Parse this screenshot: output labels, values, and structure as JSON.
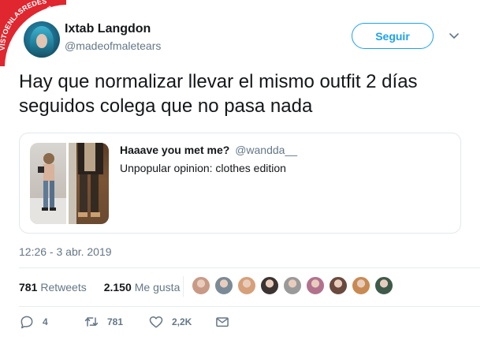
{
  "watermark": {
    "text": "VISTOENLASREDES",
    "suffix": ".com"
  },
  "author": {
    "name": "Ixtab Langdon",
    "handle": "@madeofmaletears"
  },
  "follow_button": {
    "label": "Seguir"
  },
  "tweet": {
    "text": "Hay que normalizar llevar el mismo outfit 2 días seguidos colega que no pasa nada"
  },
  "quoted_tweet": {
    "name": "Haaave you met me?",
    "handle": "@wandda__",
    "text": "Unpopular opinion: clothes edition"
  },
  "timestamp": "12:26 - 3 abr. 2019",
  "stats": {
    "retweets_count": "781",
    "retweets_label": "Retweets",
    "likes_count": "2.150",
    "likes_label": "Me gusta"
  },
  "liker_avatars": [
    {
      "color": "#c89a86"
    },
    {
      "color": "#7a8a96"
    },
    {
      "color": "#d6a07a"
    },
    {
      "color": "#3c3432"
    },
    {
      "color": "#9a9a9a"
    },
    {
      "color": "#b2728e"
    },
    {
      "color": "#6a4a3e"
    },
    {
      "color": "#c88a52"
    },
    {
      "color": "#3e5a4a"
    }
  ],
  "actions": {
    "replies": "4",
    "retweets": "781",
    "likes": "2,2K"
  },
  "colors": {
    "accent": "#1da1f2",
    "secondary_text": "#657786",
    "border": "#e1e8ed",
    "watermark_red": "#e0262f"
  }
}
